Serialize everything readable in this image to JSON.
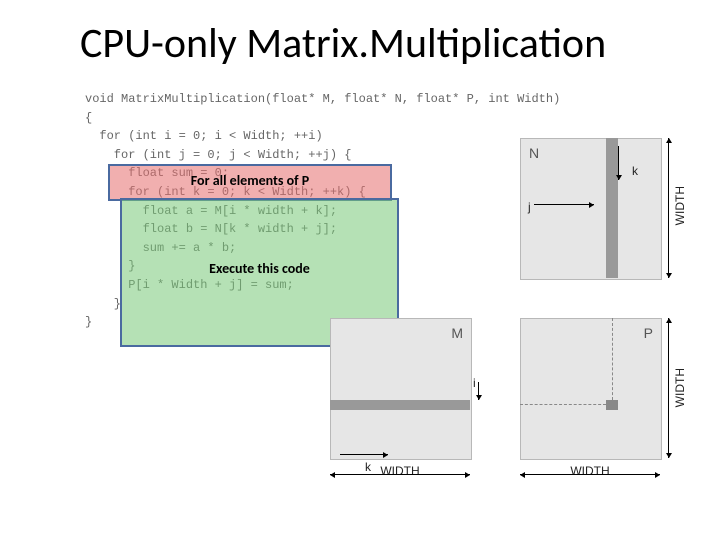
{
  "title": "CPU-only Matrix.Multiplication",
  "code": {
    "l0": "void MatrixMultiplication(float* M, float* N, float* P, int Width)",
    "l1": "{",
    "l2": "  for (int i = 0; i < Width; ++i)",
    "l3": "    for (int j = 0; j < Width; ++j) {",
    "l4": "      float sum = 0;",
    "l5": "      for (int k = 0; k < Width; ++k) {",
    "l6": "        float a = M[i * width + k];",
    "l7": "        float b = N[k * width + j];",
    "l8": "        sum += a * b;",
    "l9": "      }",
    "l10": "      P[i * Width + j] = sum;",
    "l11": "    }",
    "l12": "}"
  },
  "overlay": {
    "loops_label": "For all elements of P",
    "body_label": "Execute this code"
  },
  "diagram": {
    "N": "N",
    "M": "M",
    "P": "P",
    "k": "k",
    "j": "j",
    "i": "i",
    "width": "WIDTH"
  }
}
